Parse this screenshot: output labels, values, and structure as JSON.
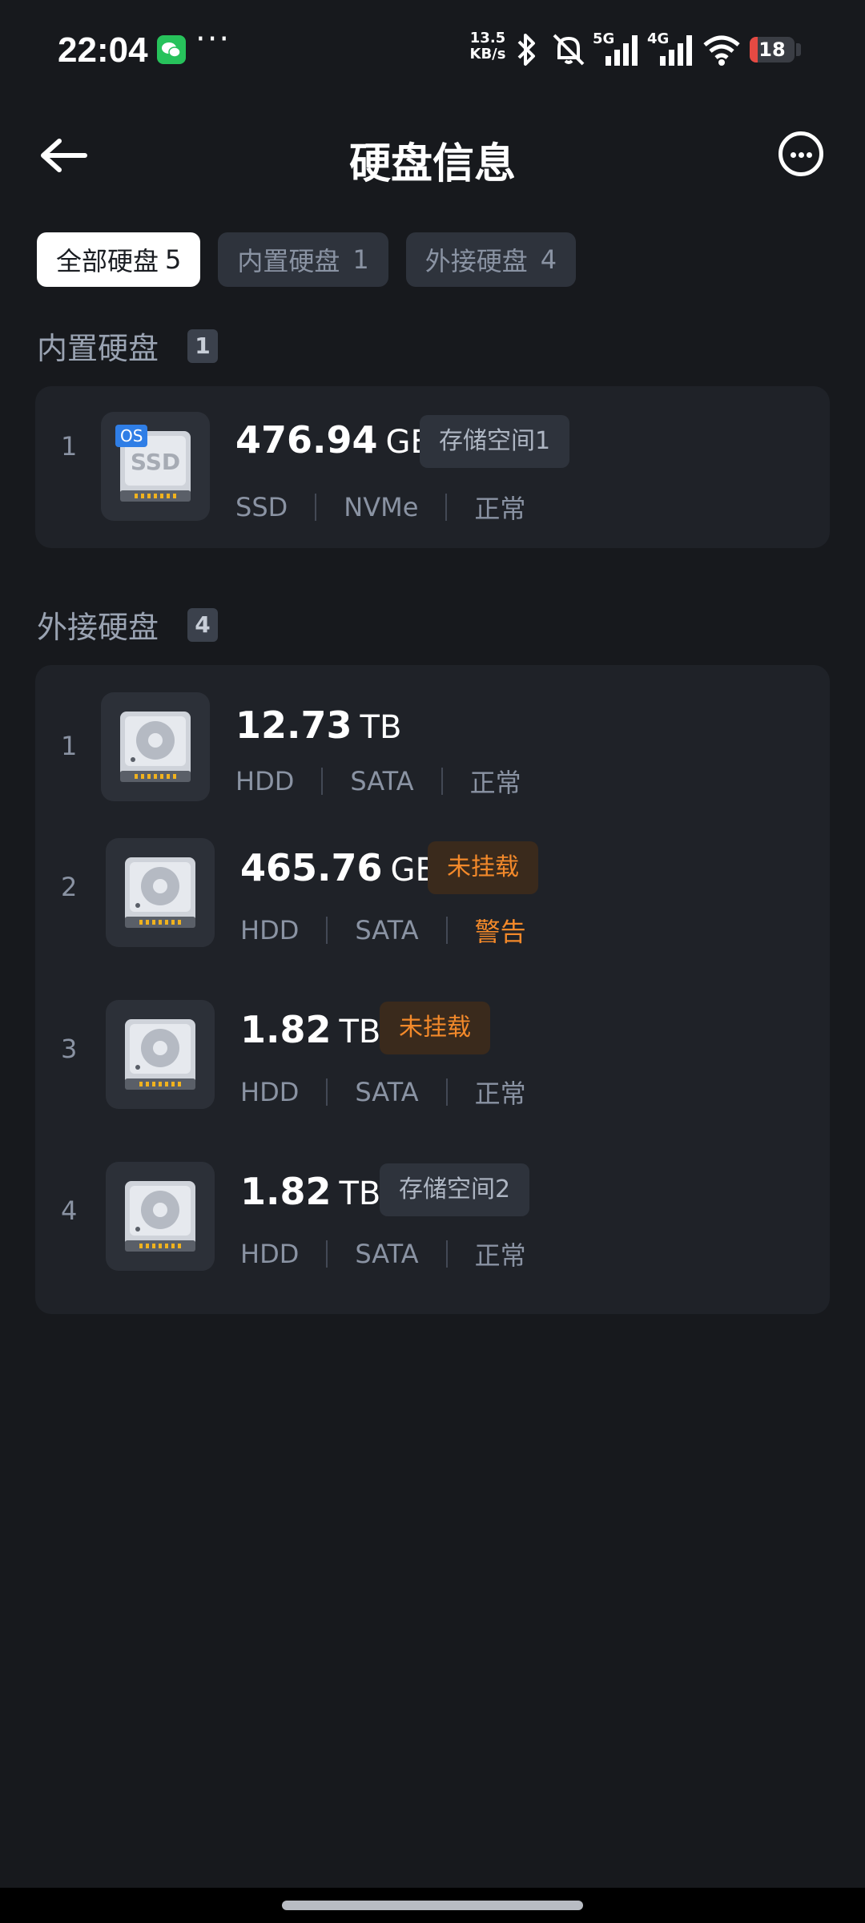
{
  "status_bar": {
    "time": "22:04",
    "more": "···",
    "net_speed_value": "13.5",
    "net_speed_unit": "KB/s",
    "sig1_label": "5G",
    "sig2_label": "4G",
    "battery_level": "18",
    "battery_fraction": 0.18,
    "battery_color": "#e54a43",
    "icons": [
      "wechat-icon",
      "bluetooth-icon",
      "mute-icon",
      "signal-5g-icon",
      "signal-4g-icon",
      "wifi-icon",
      "battery-icon"
    ]
  },
  "header": {
    "title": "硬盘信息",
    "back_icon": "arrow-left-icon",
    "more_icon": "more-circle-icon"
  },
  "tabs": [
    {
      "label": "全部硬盘",
      "count": "5",
      "active": true
    },
    {
      "label": "内置硬盘",
      "count": "1",
      "active": false
    },
    {
      "label": "外接硬盘",
      "count": "4",
      "active": false
    }
  ],
  "internal": {
    "title": "内置硬盘",
    "count": "1",
    "disks": [
      {
        "index": "1",
        "os_tag": "OS",
        "icon_text": "SSD",
        "capacity": "476.94",
        "unit": "GB",
        "tag": "存储空间1",
        "type": "SSD",
        "interface": "NVMe",
        "status": "正常"
      }
    ]
  },
  "external": {
    "title": "外接硬盘",
    "count": "4",
    "disks": [
      {
        "index": "1",
        "capacity": "12.73",
        "unit": "TB",
        "type": "HDD",
        "interface": "SATA",
        "status": "正常"
      },
      {
        "index": "2",
        "capacity": "465.76",
        "unit": "GB",
        "tag": "未挂载",
        "type": "HDD",
        "interface": "SATA",
        "status": "警告"
      },
      {
        "index": "3",
        "capacity": "1.82",
        "unit": "TB",
        "tag": "未挂载",
        "type": "HDD",
        "interface": "SATA",
        "status": "正常"
      },
      {
        "index": "4",
        "capacity": "1.82",
        "unit": "TB",
        "tag": "存储空间2",
        "type": "HDD",
        "interface": "SATA",
        "status": "正常"
      }
    ]
  },
  "colors": {
    "background": "#17191d",
    "card": "#1f2228",
    "warning": "#f3892a",
    "os_blue": "#2f7ee6"
  }
}
